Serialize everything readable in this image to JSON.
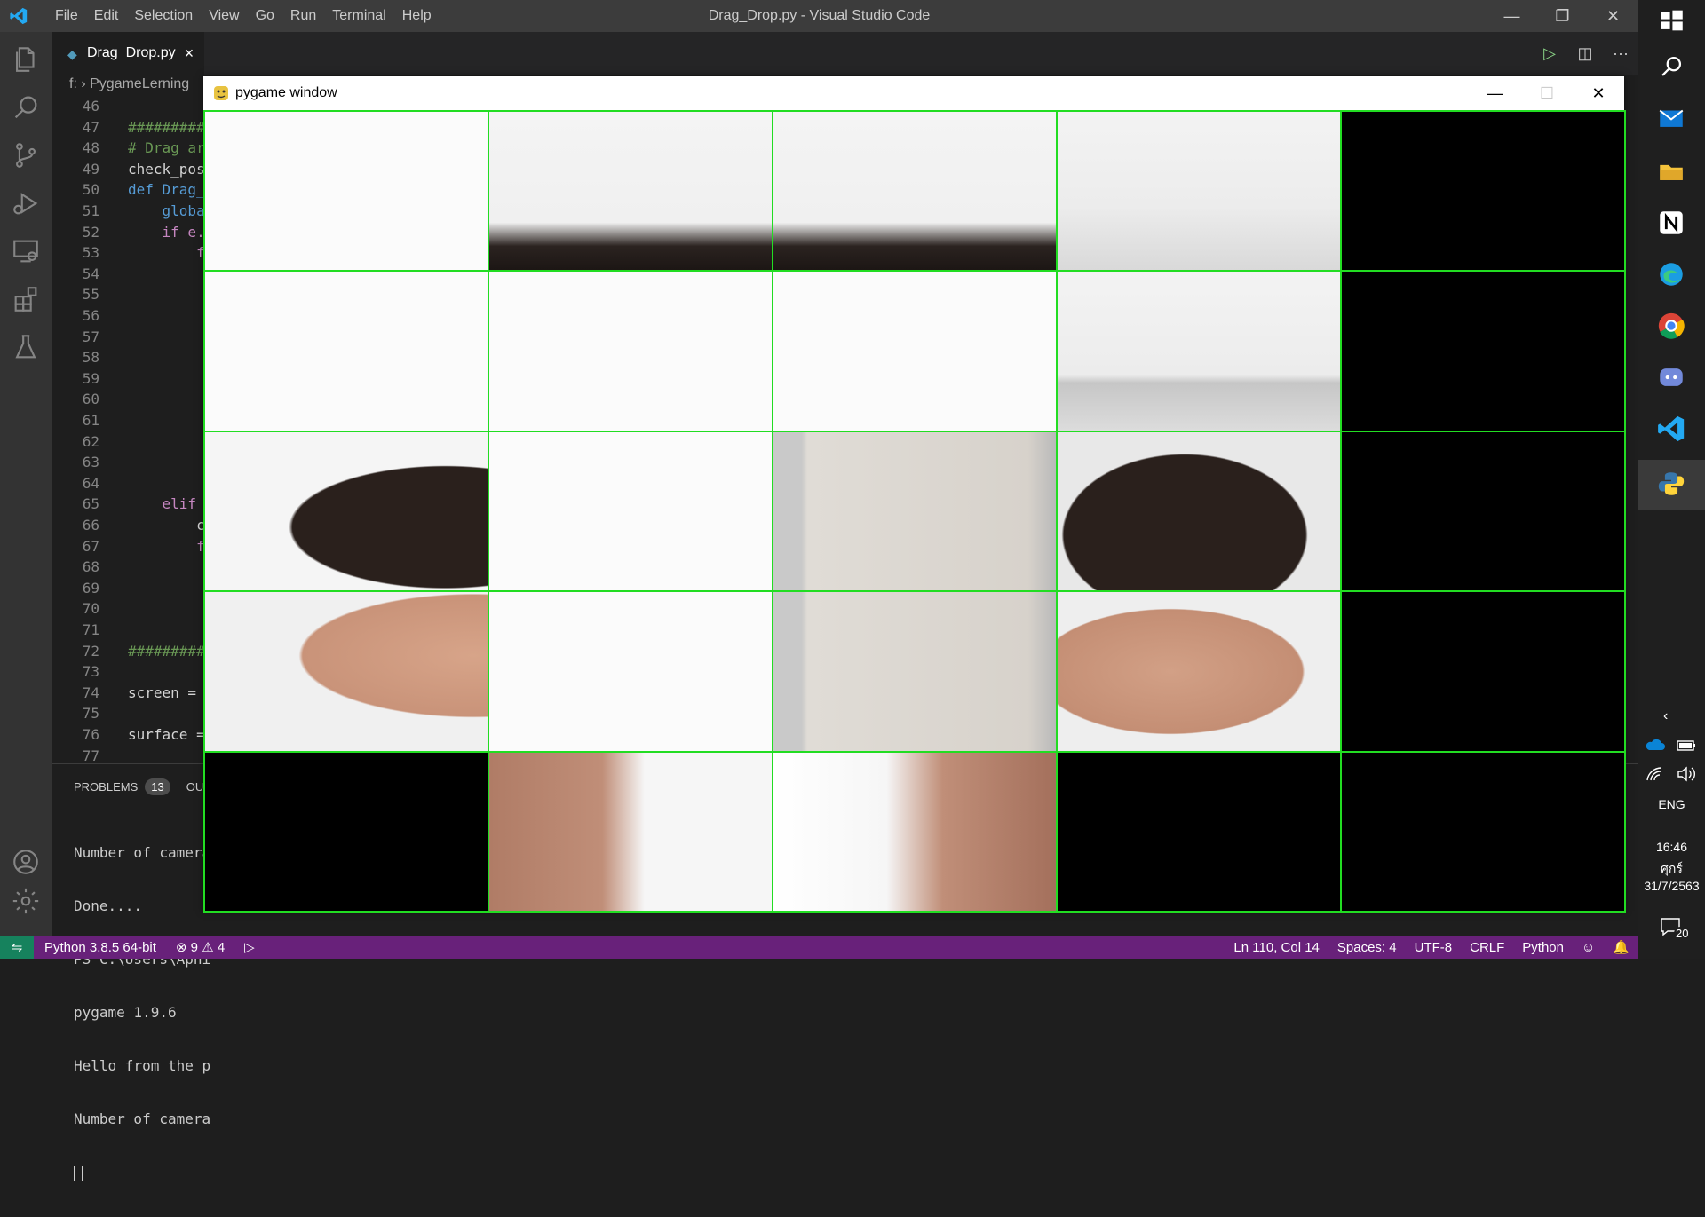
{
  "titlebar": {
    "menu": [
      "File",
      "Edit",
      "Selection",
      "View",
      "Go",
      "Run",
      "Terminal",
      "Help"
    ],
    "title": "Drag_Drop.py - Visual Studio Code"
  },
  "tab": {
    "label": "Drag_Drop.py",
    "close": "×"
  },
  "breadcrumb": {
    "drive": "f:",
    "folder": "PygameLerning"
  },
  "editor": {
    "lines": [
      {
        "n": "46",
        "t": ""
      },
      {
        "n": "47",
        "t": "##########"
      },
      {
        "n": "48",
        "t": "# Drag ar"
      },
      {
        "n": "49",
        "t": "check_pos"
      },
      {
        "n": "50",
        "t": "def Drag_"
      },
      {
        "n": "51",
        "t": "    globa"
      },
      {
        "n": "52",
        "t": "    if e."
      },
      {
        "n": "53",
        "t": "        f"
      },
      {
        "n": "54",
        "t": ""
      },
      {
        "n": "55",
        "t": ""
      },
      {
        "n": "56",
        "t": ""
      },
      {
        "n": "57",
        "t": ""
      },
      {
        "n": "58",
        "t": ""
      },
      {
        "n": "59",
        "t": ""
      },
      {
        "n": "60",
        "t": ""
      },
      {
        "n": "61",
        "t": ""
      },
      {
        "n": "62",
        "t": ""
      },
      {
        "n": "63",
        "t": ""
      },
      {
        "n": "64",
        "t": ""
      },
      {
        "n": "65",
        "t": "    elif"
      },
      {
        "n": "66",
        "t": "        c"
      },
      {
        "n": "67",
        "t": "        f"
      },
      {
        "n": "68",
        "t": ""
      },
      {
        "n": "69",
        "t": ""
      },
      {
        "n": "70",
        "t": ""
      },
      {
        "n": "71",
        "t": ""
      },
      {
        "n": "72",
        "t": "##########"
      },
      {
        "n": "73",
        "t": ""
      },
      {
        "n": "74",
        "t": "screen ="
      },
      {
        "n": "75",
        "t": ""
      },
      {
        "n": "76",
        "t": "surface ="
      },
      {
        "n": "77",
        "t": ""
      }
    ]
  },
  "panel": {
    "problems_label": "PROBLEMS",
    "problems_count": "13",
    "output_label": "OU",
    "terminal_lines": [
      "Number of camera",
      "Done....",
      "PS C:\\Users\\Aphi",
      "pygame 1.9.6",
      "Hello from the p",
      "Number of camera"
    ]
  },
  "statusbar": {
    "interpreter": "Python 3.8.5 64-bit",
    "errors": "9",
    "warnings": "4",
    "position": "Ln 110, Col 14",
    "spaces": "Spaces: 4",
    "encoding": "UTF-8",
    "eol": "CRLF",
    "language": "Python"
  },
  "pygame_window": {
    "title": "pygame window",
    "grid_rows": 5,
    "grid_cols": 5,
    "grid_line_color": "#22dd22",
    "tiles": [
      [
        "white",
        "head-top",
        "head-top",
        "wall-corner",
        "black"
      ],
      [
        "white",
        "white",
        "white",
        "wall-bottom",
        "black"
      ],
      [
        "face-left-hair",
        "white",
        "door",
        "face-right-hair",
        "black"
      ],
      [
        "face-left-eye",
        "white",
        "door",
        "face-right-eye",
        "black"
      ],
      [
        "black",
        "chin-left",
        "chin-right",
        "black",
        "black"
      ]
    ]
  },
  "taskbar": {
    "language": "ENG",
    "time": "16:46",
    "day": "ศุกร์",
    "date": "31/7/2563",
    "notifications": "20"
  },
  "colors": {
    "status_bg": "#68217a",
    "remote_bg": "#16825d",
    "accent": "#007acc"
  }
}
